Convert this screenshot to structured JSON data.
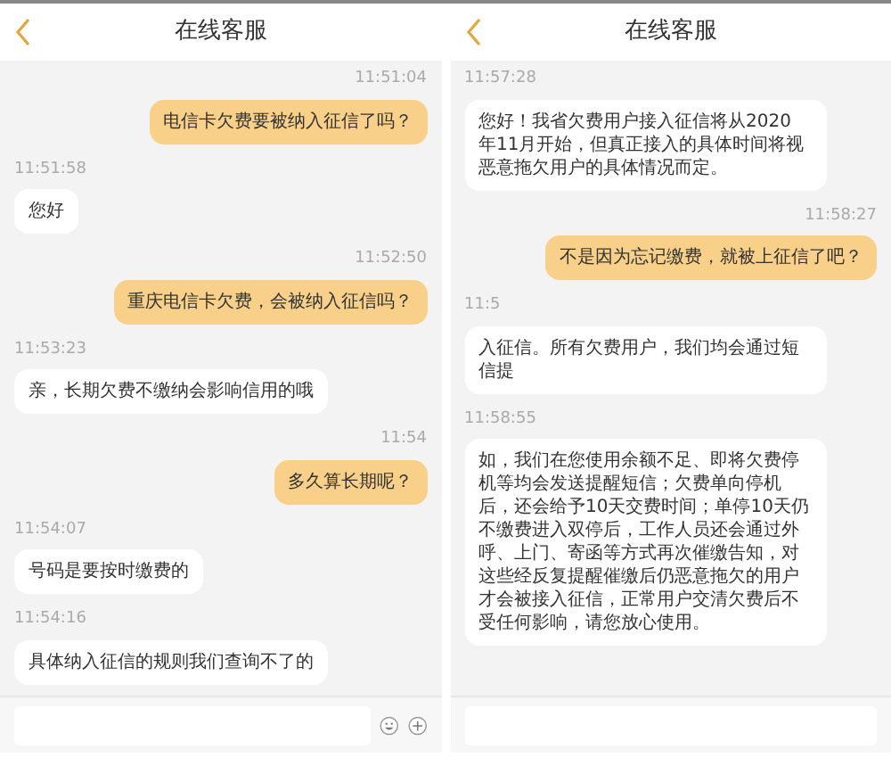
{
  "panels": [
    {
      "title": "在线客服",
      "messages": [
        {
          "kind": "outgoing",
          "time": "11:51:04",
          "text": "电信卡欠费要被纳入征信了吗？"
        },
        {
          "kind": "incoming",
          "time": "11:51:58",
          "text": "您好"
        },
        {
          "kind": "outgoing",
          "time": "11:52:50",
          "text": "重庆电信卡欠费，会被纳入征信吗？"
        },
        {
          "kind": "incoming",
          "time": "11:53:23",
          "text": "亲，长期欠费不缴纳会影响信用的哦"
        },
        {
          "kind": "outgoing",
          "time": "11:54",
          "text": "多久算长期呢？"
        },
        {
          "kind": "incoming",
          "time": "11:54:07",
          "text": "号码是要按时缴费的"
        },
        {
          "kind": "incoming",
          "time": "11:54:16",
          "text": "具体纳入征信的规则我们查询不了的"
        }
      ],
      "actions": [
        {
          "kind": "emoji"
        },
        {
          "kind": "plus"
        }
      ]
    },
    {
      "title": "在线客服",
      "messages": [
        {
          "kind": "incoming",
          "time": "11:57:28",
          "text": "您好！我省欠费用户接入征信将从2020 年11月开始，但真正接入的具体时间将视恶意拖欠用户的具体情况而定。"
        },
        {
          "kind": "outgoing",
          "time": "11:58:27",
          "text": "不是因为忘记缴费，就被上征信了吧？"
        },
        {
          "kind": "incoming",
          "time": "11:5",
          "text": "入征信。所有欠费用户，我们均会通过短信提"
        },
        {
          "kind": "incoming",
          "time": "11:58:55",
          "text": "如，我们在您使用余额不足、即将欠费停机等均会发送提醒短信；欠费单向停机后，还会给予10天交费时间；单停10天仍不缴费进入双停后，工作人员还会通过外呼、上门、寄函等方式再次催缴告知，对这些经反复提醒催缴后仍恶意拖欠的用户才会被接入征信，正常用户交清欠费后不受任何影响，请您放心使用。"
        }
      ]
    }
  ]
}
